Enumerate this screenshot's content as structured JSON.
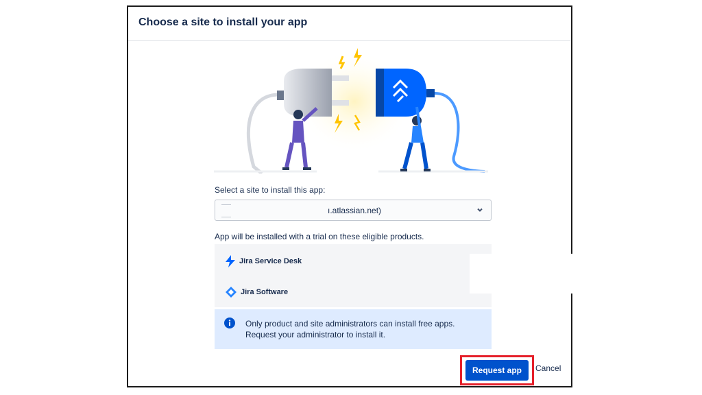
{
  "dialog": {
    "title": "Choose a site to install your app",
    "select_label": "Select a site to install this app:",
    "selected_site": "ı.atlassian.net)",
    "eligible_text": "App will be installed with a trial on these eligible products.",
    "products": [
      {
        "name": "Jira Service Desk",
        "icon": "lightning-icon"
      },
      {
        "name": "Jira Software",
        "icon": "diamond-icon"
      }
    ],
    "info": {
      "icon": "info-icon",
      "line1": "Only product and site administrators can install free apps.",
      "line2": "Request your administrator to install it."
    },
    "buttons": {
      "request": "Request app",
      "cancel": "Cancel"
    }
  },
  "colors": {
    "primary": "#0052cc",
    "highlight": "#e5202a",
    "info_bg": "#deebff",
    "panel_bg": "#f4f5f7"
  }
}
